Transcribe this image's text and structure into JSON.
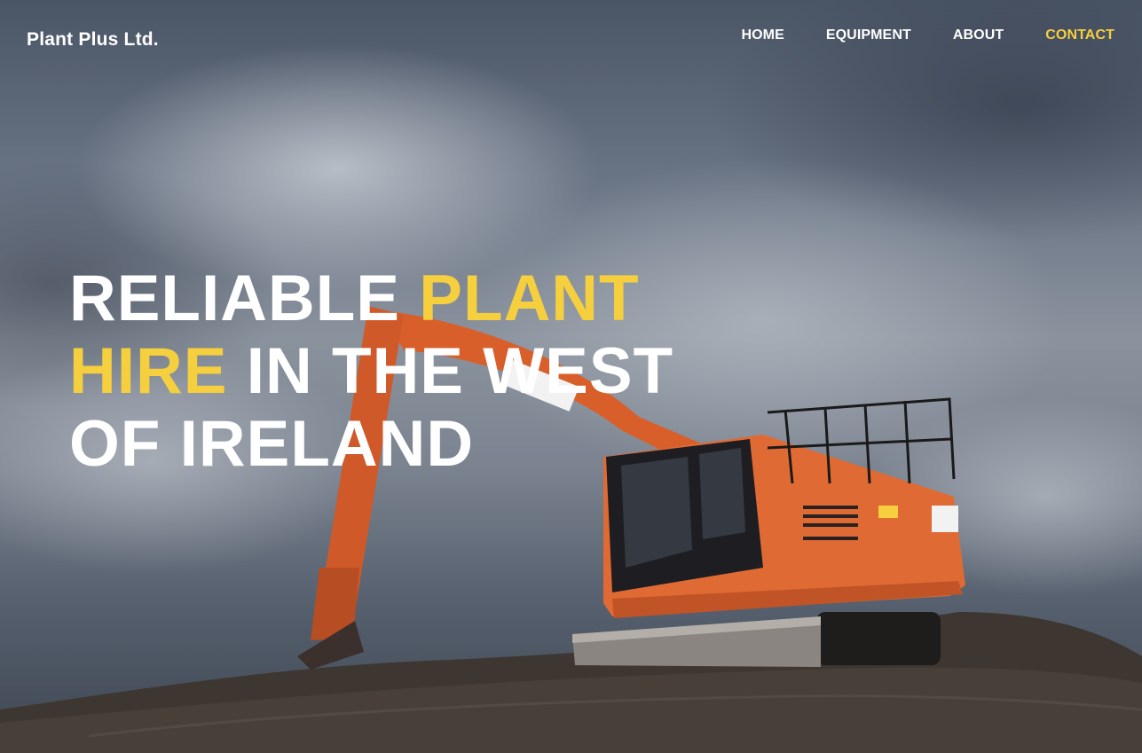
{
  "brand": {
    "name": "Plant Plus Ltd."
  },
  "nav": {
    "items": [
      {
        "label": "HOME",
        "active": false
      },
      {
        "label": "EQUIPMENT",
        "active": false
      },
      {
        "label": "ABOUT",
        "active": false
      },
      {
        "label": "CONTACT",
        "active": true
      }
    ]
  },
  "hero": {
    "headline": {
      "line1_white": "RELIABLE ",
      "line1_accent": "PLANT",
      "line2_accent": "HIRE",
      "line2_white": " IN THE WEST",
      "line3_white": "OF IRELAND"
    },
    "image_subject": "orange excavator on hill under cloudy sky"
  },
  "colors": {
    "accent": "#f5cf3e",
    "text": "#ffffff",
    "machine": "#e06a34"
  }
}
